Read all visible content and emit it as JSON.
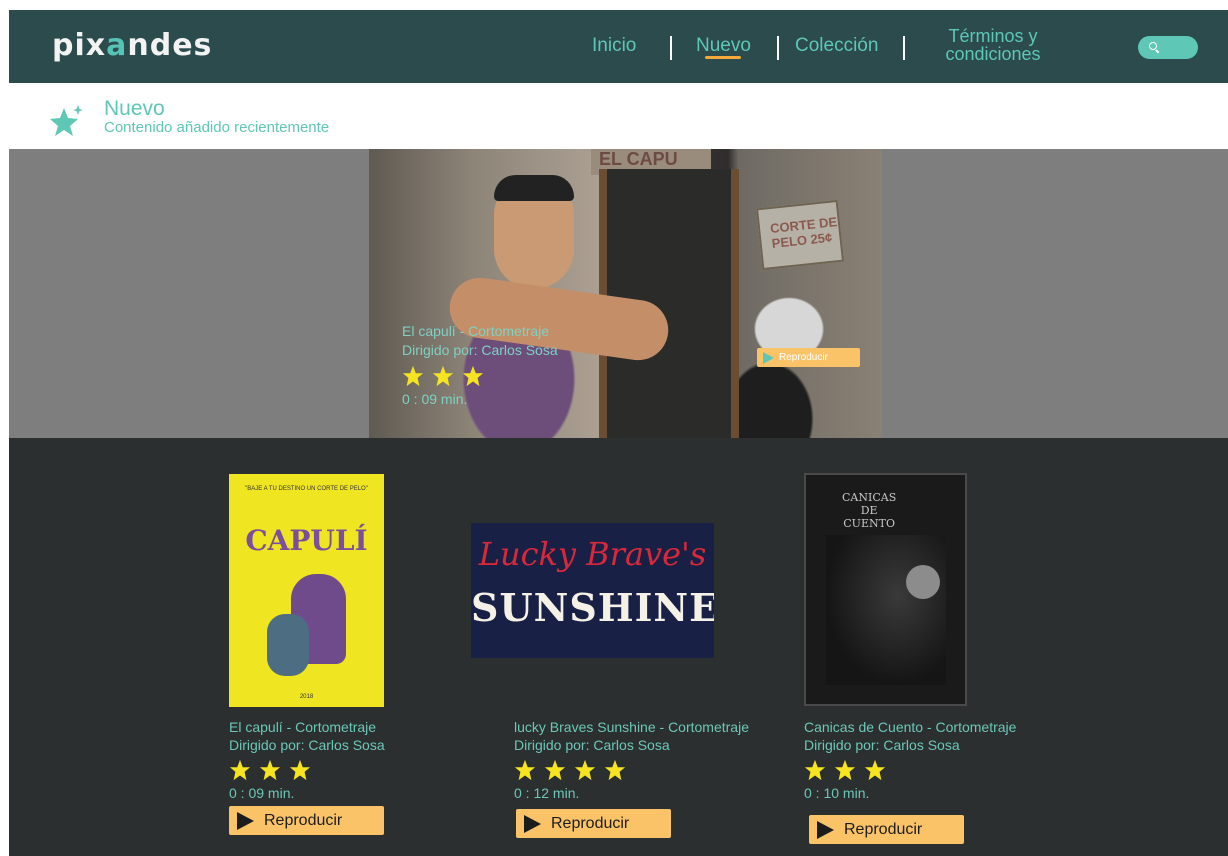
{
  "header": {
    "logo_prefix": "pix",
    "logo_accent": "a",
    "logo_suffix": "ndes",
    "nav": {
      "inicio": "Inicio",
      "nuevo": "Nuevo",
      "coleccion": "Colección",
      "terminos_line1": "Términos y",
      "terminos_line2": "condiciones"
    },
    "search_icon": "search-icon",
    "colors": {
      "bar": "#2b4b4d",
      "accent": "#5ec7b6",
      "underline": "#f3a93b"
    }
  },
  "section": {
    "title": "Nuevo",
    "subtitle": "Contenido añadido recientemente",
    "icon": "star-sparkle-icon"
  },
  "featured": {
    "title": "El capulí - Cortometraje",
    "director": "Dirigido por: Carlos Sosa",
    "rating": 3,
    "duration": "0 : 09 min.",
    "play_label": "Reproducir",
    "image_sign_top": "EL CAPU",
    "image_sign_side": "CORTE DE PELO 25¢"
  },
  "movies": [
    {
      "poster_tagline": "\"BAJE A TU DESTINO UN CORTE DE PELO\"",
      "poster_title": "CAPULÍ",
      "poster_year": "2018",
      "title": "El capulí - Cortometraje",
      "director": "Dirigido por: Carlos Sosa",
      "rating": 3,
      "duration": "0 : 09 min.",
      "play_label": "Reproducir"
    },
    {
      "poster_line1": "Lucky Brave's",
      "poster_line2": "SUNSHINE",
      "title": "lucky Braves Sunshine - Cortometraje",
      "director": "Dirigido por: Carlos Sosa",
      "rating": 4,
      "duration": "0 : 12 min.",
      "play_label": "Reproducir"
    },
    {
      "poster_title_line1": "CANICAS",
      "poster_title_line2": "DE",
      "poster_title_line3": "CUENTO",
      "title": "Canicas de Cuento - Cortometraje",
      "director": "Dirigido por: Carlos Sosa",
      "rating": 3,
      "duration": "0 : 10 min.",
      "play_label": "Reproducir"
    }
  ],
  "colors": {
    "star": "#f6e421",
    "button": "#fbc368",
    "collection_bg": "#2b2f30",
    "hero_bg": "#7e7e7e"
  }
}
